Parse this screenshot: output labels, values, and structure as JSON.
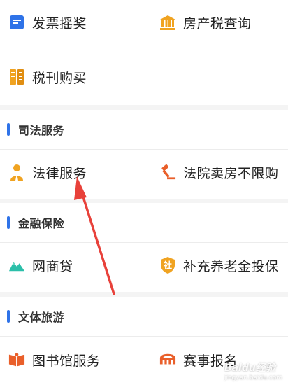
{
  "colors": {
    "accent": "#2f73e8",
    "page_bg": "#f4f4f4",
    "icon_orange": "#f0a321",
    "icon_red": "#e95f2a",
    "icon_teal": "#2bbfa9",
    "arrow_red": "#e8413a"
  },
  "section_top": {
    "items": [
      {
        "label": "发票摇奖",
        "icon": "invoice-icon"
      },
      {
        "label": "房产税查询",
        "icon": "bank-building-icon"
      },
      {
        "label": "税刊购买",
        "icon": "tax-magazine-icon"
      }
    ]
  },
  "judicial": {
    "title": "司法服务",
    "items": [
      {
        "label": "法律服务",
        "icon": "lawyer-icon"
      },
      {
        "label": "法院卖房不限购",
        "icon": "gavel-icon"
      }
    ]
  },
  "finance": {
    "title": "金融保险",
    "items": [
      {
        "label": "网商贷",
        "icon": "mountain-loan-icon"
      },
      {
        "label": "补充养老金投保",
        "icon": "pension-shield-icon"
      }
    ],
    "pension_badge": "社"
  },
  "culture": {
    "title": "文体旅游",
    "items": [
      {
        "label": "图书馆服务",
        "icon": "book-icon"
      },
      {
        "label": "赛事报名",
        "icon": "stadium-icon"
      }
    ]
  },
  "watermark": {
    "text": "Baidu经验",
    "sub": "jingyan.baidu.com"
  }
}
